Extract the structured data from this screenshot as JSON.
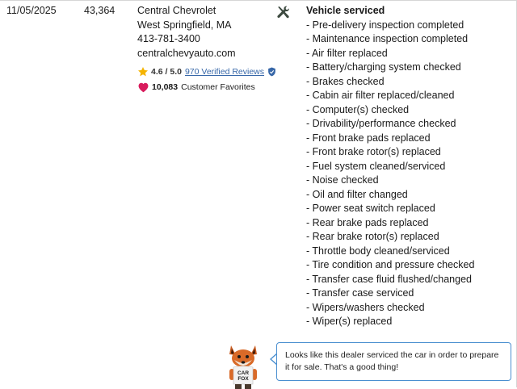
{
  "record": {
    "date": "11/05/2025",
    "odometer": "43,364"
  },
  "dealer": {
    "name": "Central Chevrolet",
    "location": "West Springfield, MA",
    "phone": "413-781-3400",
    "website": "centralchevyauto.com",
    "rating": "4.6 / 5.0",
    "reviews_link": "970 Verified Reviews",
    "favorites_count": "10,083",
    "favorites_label": "Customer Favorites"
  },
  "service": {
    "title": "Vehicle serviced",
    "items": [
      "- Pre-delivery inspection completed",
      "- Maintenance inspection completed",
      "- Air filter replaced",
      "- Battery/charging system checked",
      "- Brakes checked",
      "- Cabin air filter replaced/cleaned",
      "- Computer(s) checked",
      "- Drivability/performance checked",
      "- Front brake pads replaced",
      "- Front brake rotor(s) replaced",
      "- Fuel system cleaned/serviced",
      "- Noise checked",
      "- Oil and filter changed",
      "- Power seat switch replaced",
      "- Rear brake pads replaced",
      "- Rear brake rotor(s) replaced",
      "- Throttle body cleaned/serviced",
      "- Tire condition and pressure checked",
      "- Transfer case fluid flushed/changed",
      "- Transfer case serviced",
      "- Wipers/washers checked",
      "- Wiper(s) replaced"
    ]
  },
  "mascot": {
    "shirt_line1": "CAR",
    "shirt_line2": "FOX",
    "message": "Looks like this dealer serviced the car in order to prepare it for sale. That's a good thing!"
  },
  "icons": {
    "service": "wrench-screwdriver-icon",
    "rating": "star-icon",
    "verified": "shield-check-icon",
    "favorites": "heart-icon"
  },
  "colors": {
    "link": "#3767a8",
    "star": "#f5b400",
    "heart": "#d81b5c",
    "bubble_border": "#4a8fd0",
    "tool_icon": "#3d4a40"
  }
}
